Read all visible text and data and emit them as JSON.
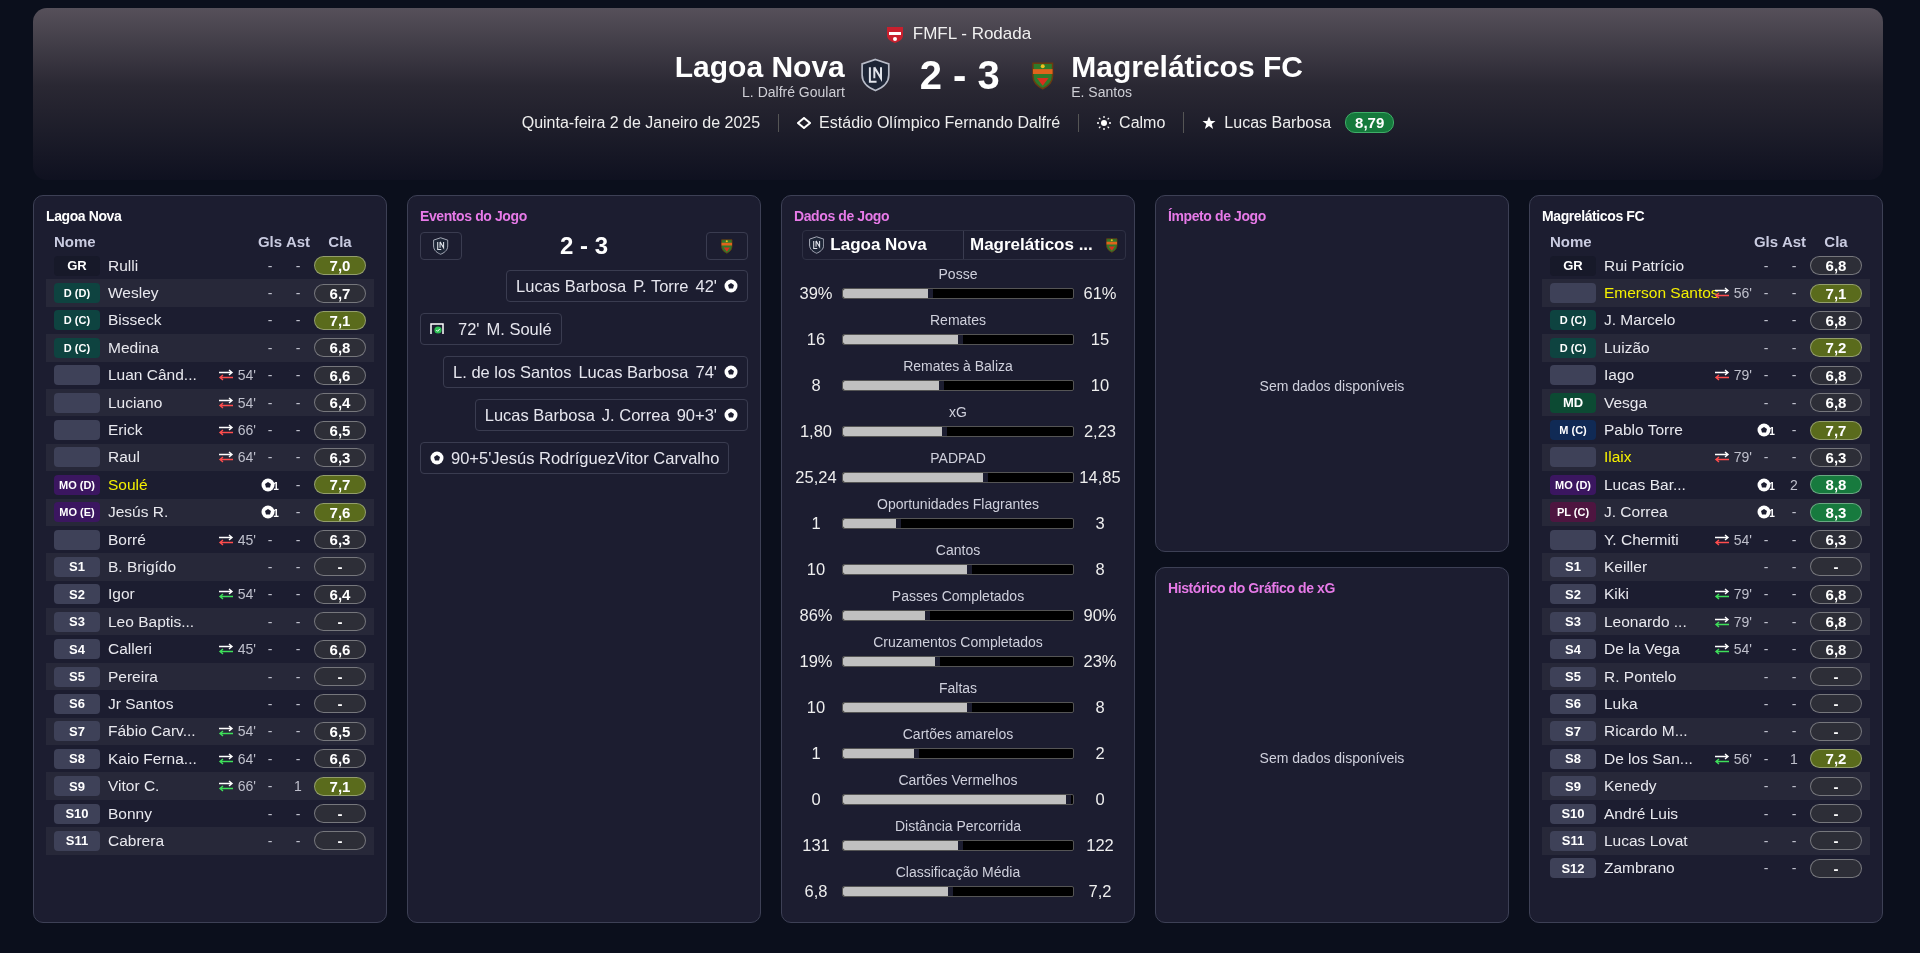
{
  "header": {
    "competition": "FMFL - Rodada",
    "home": {
      "name": "Lagoa Nova",
      "manager": "L. Dalfré Goulart"
    },
    "score": "2 - 3",
    "away": {
      "name": "Magreláticos FC",
      "manager": "E. Santos"
    },
    "date": "Quinta-feira 2 de Janeiro de 2025",
    "stadium": "Estádio Olímpico Fernando Dalfré",
    "weather": "Calmo",
    "best_player": "Lucas Barbosa",
    "best_rating": "8,79"
  },
  "home_panel": {
    "title": "Lagoa Nova",
    "columns": [
      "Nome",
      "Gls",
      "Ast",
      "Cla"
    ],
    "rows": [
      {
        "pos": "GR",
        "kind": "gk",
        "name": "Rulli",
        "highlighted": false,
        "scored": false,
        "goals": "-",
        "assists": "-",
        "rating": "7,0",
        "color": "#5a6b1c"
      },
      {
        "pos": "D (D)",
        "kind": "def",
        "name": "Wesley",
        "highlighted": false,
        "scored": false,
        "goals": "-",
        "assists": "-",
        "rating": "6,7",
        "color": "#2d2e37"
      },
      {
        "pos": "D (C)",
        "kind": "def",
        "name": "Bisseck",
        "highlighted": false,
        "scored": false,
        "goals": "-",
        "assists": "-",
        "rating": "7,1",
        "color": "#5a6b1c"
      },
      {
        "pos": "D (C)",
        "kind": "def",
        "name": "Medina",
        "highlighted": false,
        "scored": false,
        "goals": "-",
        "assists": "-",
        "rating": "6,8",
        "color": "#2d2e37"
      },
      {
        "kind": "blank",
        "name": "Luan Când...",
        "highlighted": false,
        "sub": {
          "kind": "off",
          "minute": "54'"
        },
        "scored": false,
        "goals": "-",
        "assists": "-",
        "rating": "6,6",
        "color": "#2d2e37"
      },
      {
        "kind": "blank",
        "name": "Luciano",
        "highlighted": false,
        "sub": {
          "kind": "off",
          "minute": "54'"
        },
        "scored": false,
        "goals": "-",
        "assists": "-",
        "rating": "6,4",
        "color": "#2d2e37"
      },
      {
        "kind": "blank",
        "name": "Erick",
        "highlighted": false,
        "sub": {
          "kind": "off",
          "minute": "66'"
        },
        "scored": false,
        "goals": "-",
        "assists": "-",
        "rating": "6,5",
        "color": "#2d2e37"
      },
      {
        "kind": "blank",
        "name": "Raul",
        "highlighted": false,
        "sub": {
          "kind": "off",
          "minute": "64'"
        },
        "scored": false,
        "goals": "-",
        "assists": "-",
        "rating": "6,3",
        "color": "#2d2e37"
      },
      {
        "pos": "MO (D)",
        "kind": "am",
        "name": "Soulé",
        "highlighted": true,
        "scored": true,
        "goals": "1",
        "assists": "-",
        "rating": "7,7",
        "color": "#5a6b1c"
      },
      {
        "pos": "MO (E)",
        "kind": "am",
        "name": "Jesús R.",
        "highlighted": false,
        "scored": true,
        "goals": "1",
        "assists": "-",
        "rating": "7,6",
        "color": "#5a6b1c"
      },
      {
        "kind": "blank",
        "name": "Borré",
        "highlighted": false,
        "sub": {
          "kind": "off",
          "minute": "45'"
        },
        "scored": false,
        "goals": "-",
        "assists": "-",
        "rating": "6,3",
        "color": "#2d2e37"
      },
      {
        "pos": "S1",
        "kind": "sub",
        "name": "B. Brigído",
        "highlighted": false,
        "scored": false,
        "goals": "-",
        "assists": "-",
        "rating": "-",
        "color": "#2d2e37"
      },
      {
        "pos": "S2",
        "kind": "sub",
        "name": "Igor",
        "highlighted": false,
        "sub": {
          "kind": "on",
          "minute": "54'"
        },
        "scored": false,
        "goals": "-",
        "assists": "-",
        "rating": "6,4",
        "color": "#2d2e37"
      },
      {
        "pos": "S3",
        "kind": "sub",
        "name": "Leo Baptis...",
        "highlighted": false,
        "scored": false,
        "goals": "-",
        "assists": "-",
        "rating": "-",
        "color": "#2d2e37"
      },
      {
        "pos": "S4",
        "kind": "sub",
        "name": "Calleri",
        "highlighted": false,
        "sub": {
          "kind": "on",
          "minute": "45'"
        },
        "scored": false,
        "goals": "-",
        "assists": "-",
        "rating": "6,6",
        "color": "#2d2e37"
      },
      {
        "pos": "S5",
        "kind": "sub",
        "name": "Pereira",
        "highlighted": false,
        "scored": false,
        "goals": "-",
        "assists": "-",
        "rating": "-",
        "color": "#2d2e37"
      },
      {
        "pos": "S6",
        "kind": "sub",
        "name": "Jr Santos",
        "highlighted": false,
        "scored": false,
        "goals": "-",
        "assists": "-",
        "rating": "-",
        "color": "#2d2e37"
      },
      {
        "pos": "S7",
        "kind": "sub",
        "name": "Fábio Carv...",
        "highlighted": false,
        "sub": {
          "kind": "on",
          "minute": "54'"
        },
        "scored": false,
        "goals": "-",
        "assists": "-",
        "rating": "6,5",
        "color": "#2d2e37"
      },
      {
        "pos": "S8",
        "kind": "sub",
        "name": "Kaio Ferna...",
        "highlighted": false,
        "sub": {
          "kind": "on",
          "minute": "64'"
        },
        "scored": false,
        "goals": "-",
        "assists": "-",
        "rating": "6,6",
        "color": "#2d2e37"
      },
      {
        "pos": "S9",
        "kind": "sub",
        "name": "Vitor C.",
        "highlighted": false,
        "sub": {
          "kind": "on",
          "minute": "66'"
        },
        "scored": false,
        "goals": "-",
        "assists": "1",
        "rating": "7,1",
        "color": "#5a6b1c"
      },
      {
        "pos": "S10",
        "kind": "sub",
        "name": "Bonny",
        "highlighted": false,
        "scored": false,
        "goals": "-",
        "assists": "-",
        "rating": "-",
        "color": "#2d2e37"
      },
      {
        "pos": "S11",
        "kind": "sub",
        "name": "Cabrera",
        "highlighted": false,
        "scored": false,
        "goals": "-",
        "assists": "-",
        "rating": "-",
        "color": "#2d2e37"
      }
    ]
  },
  "events_panel": {
    "title": "Eventos do Jogo",
    "score": "2 - 3",
    "events": [
      {
        "kind": "away-goal",
        "texts": [
          "Lucas Barbosa",
          "P. Torre",
          "42'"
        ]
      },
      {
        "kind": "home-save",
        "texts": [
          "72'",
          "M. Soulé"
        ]
      },
      {
        "kind": "away-goal",
        "texts": [
          "L. de los Santos",
          "Lucas Barbosa",
          "74'"
        ]
      },
      {
        "kind": "away-goal",
        "texts": [
          "Lucas Barbosa",
          "J. Correa",
          "90+3'"
        ]
      },
      {
        "kind": "home-goal",
        "texts": [
          "90+5'Jesús RodríguezVitor Carvalho"
        ]
      }
    ]
  },
  "stats_panel": {
    "title": "Dados de Jogo",
    "home_tab": "Lagoa Nova",
    "away_tab": "Magreláticos ...",
    "stats": [
      {
        "label": "Posse",
        "home": "39%",
        "away": "61%",
        "level": 0.39
      },
      {
        "label": "Remates",
        "home": "16",
        "away": "15",
        "level": 0.52
      },
      {
        "label": "Remates à Baliza",
        "home": "8",
        "away": "10",
        "level": 0.44
      },
      {
        "label": "xG",
        "home": "1,80",
        "away": "2,23",
        "level": 0.45
      },
      {
        "label": "PADPAD",
        "home": "25,24",
        "away": "14,85",
        "level": 0.63
      },
      {
        "label": "Oportunidades Flagrantes",
        "home": "1",
        "away": "3",
        "level": 0.25
      },
      {
        "label": "Cantos",
        "home": "10",
        "away": "8",
        "level": 0.56
      },
      {
        "label": "Passes Completados",
        "home": "86%",
        "away": "90%",
        "level": 0.38
      },
      {
        "label": "Cruzamentos Completados",
        "home": "19%",
        "away": "23%",
        "level": 0.42
      },
      {
        "label": "Faltas",
        "home": "10",
        "away": "8",
        "level": 0.56
      },
      {
        "label": "Cartões amarelos",
        "home": "1",
        "away": "2",
        "level": 0.33
      },
      {
        "label": "Cartões Vermelhos",
        "home": "0",
        "away": "0",
        "level": 0.99
      },
      {
        "label": "Distância Percorrida",
        "home": "131",
        "away": "122",
        "level": 0.52
      },
      {
        "label": "Classificação Média",
        "home": "6,8",
        "away": "7,2",
        "level": 0.48
      }
    ]
  },
  "momentum_panel": {
    "title": "Ímpeto de Jogo",
    "empty_text": "Sem dados disponíveis"
  },
  "xg_panel": {
    "title": "Histórico do Gráfico de xG",
    "empty_text": "Sem dados disponíveis"
  },
  "away_panel": {
    "title": "Magreláticos FC",
    "columns": [
      "Nome",
      "Gls",
      "Ast",
      "Cla"
    ],
    "rows": [
      {
        "pos": "GR",
        "kind": "gk",
        "name": "Rui Patrício",
        "highlighted": false,
        "scored": false,
        "goals": "-",
        "assists": "-",
        "rating": "6,8",
        "color": "#2d2e37"
      },
      {
        "kind": "blank",
        "name": "Emerson Santos",
        "highlighted": true,
        "sub": {
          "kind": "off",
          "minute": "56'"
        },
        "scored": false,
        "goals": "-",
        "assists": "-",
        "rating": "7,1",
        "color": "#5a6b1c"
      },
      {
        "pos": "D (C)",
        "kind": "def",
        "name": "J. Marcelo",
        "highlighted": false,
        "scored": false,
        "goals": "-",
        "assists": "-",
        "rating": "6,8",
        "color": "#2d2e37"
      },
      {
        "pos": "D (C)",
        "kind": "def",
        "name": "Luizão",
        "highlighted": false,
        "scored": false,
        "goals": "-",
        "assists": "-",
        "rating": "7,2",
        "color": "#5a6b1c"
      },
      {
        "kind": "blank",
        "name": "Iago",
        "highlighted": false,
        "sub": {
          "kind": "off",
          "minute": "79'"
        },
        "scored": false,
        "goals": "-",
        "assists": "-",
        "rating": "6,8",
        "color": "#2d2e37"
      },
      {
        "pos": "MD",
        "kind": "dm",
        "name": "Vesga",
        "highlighted": false,
        "scored": false,
        "goals": "-",
        "assists": "-",
        "rating": "6,8",
        "color": "#2d2e37"
      },
      {
        "pos": "M (C)",
        "kind": "mid",
        "name": "Pablo Torre",
        "highlighted": false,
        "scored": true,
        "goals": "1",
        "assists": "-",
        "rating": "7,7",
        "color": "#5a6b1c"
      },
      {
        "kind": "blank",
        "name": "Ilaix",
        "highlighted": true,
        "sub": {
          "kind": "off",
          "minute": "79'"
        },
        "scored": false,
        "goals": "-",
        "assists": "-",
        "rating": "6,3",
        "color": "#2d2e37"
      },
      {
        "pos": "MO (D)",
        "kind": "am",
        "name": "Lucas Bar...",
        "highlighted": false,
        "scored": true,
        "goals": "1",
        "assists": "2",
        "rating": "8,8",
        "color": "#177a3e"
      },
      {
        "pos": "PL (C)",
        "kind": "st",
        "name": "J. Correa",
        "highlighted": false,
        "scored": true,
        "goals": "1",
        "assists": "-",
        "rating": "8,3",
        "color": "#177a3e"
      },
      {
        "kind": "blank",
        "name": "Y. Chermiti",
        "highlighted": false,
        "sub": {
          "kind": "off",
          "minute": "54'"
        },
        "scored": false,
        "goals": "-",
        "assists": "-",
        "rating": "6,3",
        "color": "#2d2e37"
      },
      {
        "pos": "S1",
        "kind": "sub",
        "name": "Keiller",
        "highlighted": false,
        "scored": false,
        "goals": "-",
        "assists": "-",
        "rating": "-",
        "color": "#2d2e37"
      },
      {
        "pos": "S2",
        "kind": "sub",
        "name": "Kiki",
        "highlighted": false,
        "sub": {
          "kind": "on",
          "minute": "79'"
        },
        "scored": false,
        "goals": "-",
        "assists": "-",
        "rating": "6,8",
        "color": "#2d2e37"
      },
      {
        "pos": "S3",
        "kind": "sub",
        "name": "Leonardo ...",
        "highlighted": false,
        "sub": {
          "kind": "on",
          "minute": "79'"
        },
        "scored": false,
        "goals": "-",
        "assists": "-",
        "rating": "6,8",
        "color": "#2d2e37"
      },
      {
        "pos": "S4",
        "kind": "sub",
        "name": "De la Vega",
        "highlighted": false,
        "sub": {
          "kind": "on",
          "minute": "54'"
        },
        "scored": false,
        "goals": "-",
        "assists": "-",
        "rating": "6,8",
        "color": "#2d2e37"
      },
      {
        "pos": "S5",
        "kind": "sub",
        "name": "R. Pontelo",
        "highlighted": false,
        "scored": false,
        "goals": "-",
        "assists": "-",
        "rating": "-",
        "color": "#2d2e37"
      },
      {
        "pos": "S6",
        "kind": "sub",
        "name": "Luka",
        "highlighted": false,
        "scored": false,
        "goals": "-",
        "assists": "-",
        "rating": "-",
        "color": "#2d2e37"
      },
      {
        "pos": "S7",
        "kind": "sub",
        "name": "Ricardo M...",
        "highlighted": false,
        "scored": false,
        "goals": "-",
        "assists": "-",
        "rating": "-",
        "color": "#2d2e37"
      },
      {
        "pos": "S8",
        "kind": "sub",
        "name": "De los San...",
        "highlighted": false,
        "sub": {
          "kind": "on",
          "minute": "56'"
        },
        "scored": false,
        "goals": "-",
        "assists": "1",
        "rating": "7,2",
        "color": "#5a6b1c"
      },
      {
        "pos": "S9",
        "kind": "sub",
        "name": "Kenedy",
        "highlighted": false,
        "scored": false,
        "goals": "-",
        "assists": "-",
        "rating": "-",
        "color": "#2d2e37"
      },
      {
        "pos": "S10",
        "kind": "sub",
        "name": "André Luis",
        "highlighted": false,
        "scored": false,
        "goals": "-",
        "assists": "-",
        "rating": "-",
        "color": "#2d2e37"
      },
      {
        "pos": "S11",
        "kind": "sub",
        "name": "Lucas Lovat",
        "highlighted": false,
        "scored": false,
        "goals": "-",
        "assists": "-",
        "rating": "-",
        "color": "#2d2e37"
      },
      {
        "pos": "S12",
        "kind": "sub",
        "name": "Zambrano",
        "highlighted": false,
        "scored": false,
        "goals": "-",
        "assists": "-",
        "rating": "-",
        "color": "#2d2e37"
      }
    ]
  }
}
